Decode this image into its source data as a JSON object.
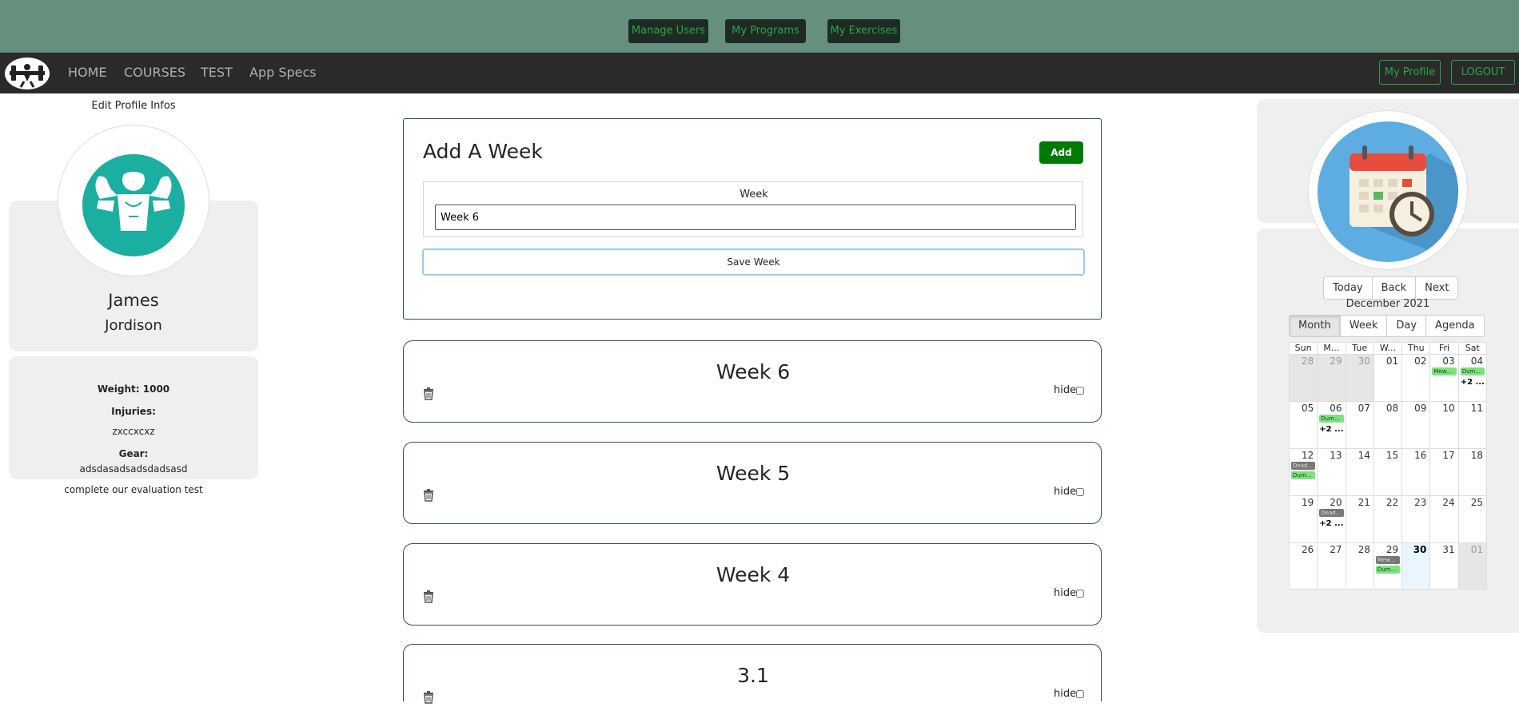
{
  "admin_bar": {
    "buttons": [
      "Manage Users",
      "My Programs",
      "My Exercises"
    ],
    "bg_color": "#678f7d",
    "accent": "#28a745"
  },
  "nav": {
    "links": [
      "HOME",
      "COURSES",
      "TEST",
      "App Specs"
    ],
    "profile_btn": "My Profile",
    "logout_btn": "LOGOUT",
    "logo_icon": "barbell-logo-icon"
  },
  "profile": {
    "edit_link": "Edit Profile Infos",
    "avatar_icon": "athlete-avatar-icon",
    "first_name": "James",
    "last_name": "Jordison",
    "weight": "Weight: 1000",
    "injuries_label": "Injuries:",
    "injuries_value": "zxccxcxz",
    "gear_label": "Gear:",
    "gear_value": "adsdasadsadsdadsasd",
    "eval_text": "complete our evaluation test"
  },
  "add_week": {
    "title": "Add A Week",
    "add_btn": "Add",
    "field_label": "Week",
    "field_value": "Week 6",
    "save_btn": "Save Week",
    "add_color": "#007a06"
  },
  "weeks": [
    {
      "title": "Week 6",
      "hide_label": "hide"
    },
    {
      "title": "Week 5",
      "hide_label": "hide"
    },
    {
      "title": "Week 4",
      "hide_label": "hide"
    },
    {
      "title": "3.1",
      "hide_label": "hide"
    }
  ],
  "calendar": {
    "avatar_icon": "calendar-clock-icon",
    "nav_buttons": [
      "Today",
      "Back",
      "Next"
    ],
    "month_label": "December 2021",
    "views": [
      "Month",
      "Week",
      "Day",
      "Agenda"
    ],
    "active_view": "Month",
    "day_headers": [
      "Sun",
      "M...",
      "Tue",
      "W...",
      "Thu",
      "Fri",
      "Sat"
    ],
    "weeks": [
      [
        {
          "d": "28",
          "off": true
        },
        {
          "d": "29",
          "off": true
        },
        {
          "d": "30",
          "off": true
        },
        {
          "d": "01"
        },
        {
          "d": "02"
        },
        {
          "d": "03",
          "events": [
            {
              "t": "Mew...",
              "c": "green"
            }
          ]
        },
        {
          "d": "04",
          "events": [
            {
              "t": "Dum...",
              "c": "green"
            }
          ],
          "more": "+2 ..."
        }
      ],
      [
        {
          "d": "05"
        },
        {
          "d": "06",
          "events": [
            {
              "t": "Dum...",
              "c": "green"
            }
          ],
          "more": "+2 ..."
        },
        {
          "d": "07"
        },
        {
          "d": "08"
        },
        {
          "d": "09"
        },
        {
          "d": "10"
        },
        {
          "d": "11"
        }
      ],
      [
        {
          "d": "12",
          "events": [
            {
              "t": "Dead...",
              "c": "gray"
            },
            {
              "t": "Dum...",
              "c": "green"
            }
          ]
        },
        {
          "d": "13"
        },
        {
          "d": "14"
        },
        {
          "d": "15"
        },
        {
          "d": "16"
        },
        {
          "d": "17"
        },
        {
          "d": "18"
        }
      ],
      [
        {
          "d": "19"
        },
        {
          "d": "20",
          "events": [
            {
              "t": "Dead...",
              "c": "gray"
            }
          ],
          "more": "+2 ..."
        },
        {
          "d": "21"
        },
        {
          "d": "22"
        },
        {
          "d": "23"
        },
        {
          "d": "24"
        },
        {
          "d": "25"
        }
      ],
      [
        {
          "d": "26"
        },
        {
          "d": "27"
        },
        {
          "d": "28"
        },
        {
          "d": "29",
          "events": [
            {
              "t": "Mew...",
              "c": "gray"
            },
            {
              "t": "Dum...",
              "c": "green"
            }
          ]
        },
        {
          "d": "30",
          "today": true
        },
        {
          "d": "31"
        },
        {
          "d": "01",
          "off": true
        }
      ]
    ]
  }
}
